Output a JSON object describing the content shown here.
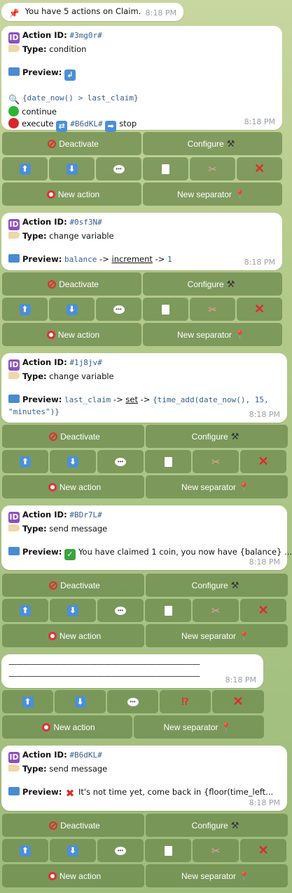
{
  "header": {
    "text": "You have 5 actions on Claim.",
    "time": "8:18 PM"
  },
  "labels": {
    "action_id": "Action ID:",
    "type": "Type:",
    "preview": "Preview:",
    "continue": "continue",
    "execute": "execute",
    "stop": "stop",
    "arrow": "->"
  },
  "keyboard": {
    "deactivate": "Deactivate",
    "configure": "Configure",
    "new_action": "New action",
    "new_separator": "New separator",
    "interrobang": "⁉"
  },
  "actions": [
    {
      "id": "#3mg0r#",
      "type": "condition",
      "condition": "{date_now() > last_claim}",
      "execute_ref": "#B6dKL#",
      "time": "8:18 PM"
    },
    {
      "id": "#0sf3N#",
      "type": "change variable",
      "preview_var": "balance",
      "preview_op": "increment",
      "preview_val": "1",
      "time": "8:18 PM"
    },
    {
      "id": "#1j8jv#",
      "type": "change variable",
      "preview_var": "last_claim",
      "preview_op": "set",
      "preview_val_1": "{time_add(date_now(), 15,",
      "preview_val_2": "\"minutes\")}",
      "time": "8:18 PM"
    },
    {
      "id": "#BDr7L#",
      "type": "send message",
      "preview_text": "You have claimed 1 coin, you now have {balance} ...",
      "time": "8:18 PM"
    },
    {
      "id": "#B6dKL#",
      "type": "send message",
      "preview_text": "It's not time yet, come back in {floor(time_left...",
      "time": "8:18 PM"
    }
  ],
  "separator": {
    "line1": "——————————————————————————",
    "line2": "——————————————————————————",
    "time": "8:18 PM"
  },
  "icons": {
    "pin": "pushpin-icon",
    "id": "id-badge-icon",
    "tag": "label-tag-icon",
    "folder": "folder-icon",
    "up": "up-arrow-icon",
    "down": "down-arrow-icon",
    "speech": "speech-bubble-icon",
    "page": "page-icon",
    "scissors": "scissors-icon",
    "cross": "cross-mark-icon",
    "target": "target-icon",
    "round_pushpin": "round-pushpin-icon",
    "hammer_pick": "hammer-and-pick-icon",
    "no_entry": "prohibited-icon"
  },
  "colors": {
    "link_mono": "#335f8f",
    "button_bg": "#69874b",
    "danger": "#e02a2a"
  }
}
